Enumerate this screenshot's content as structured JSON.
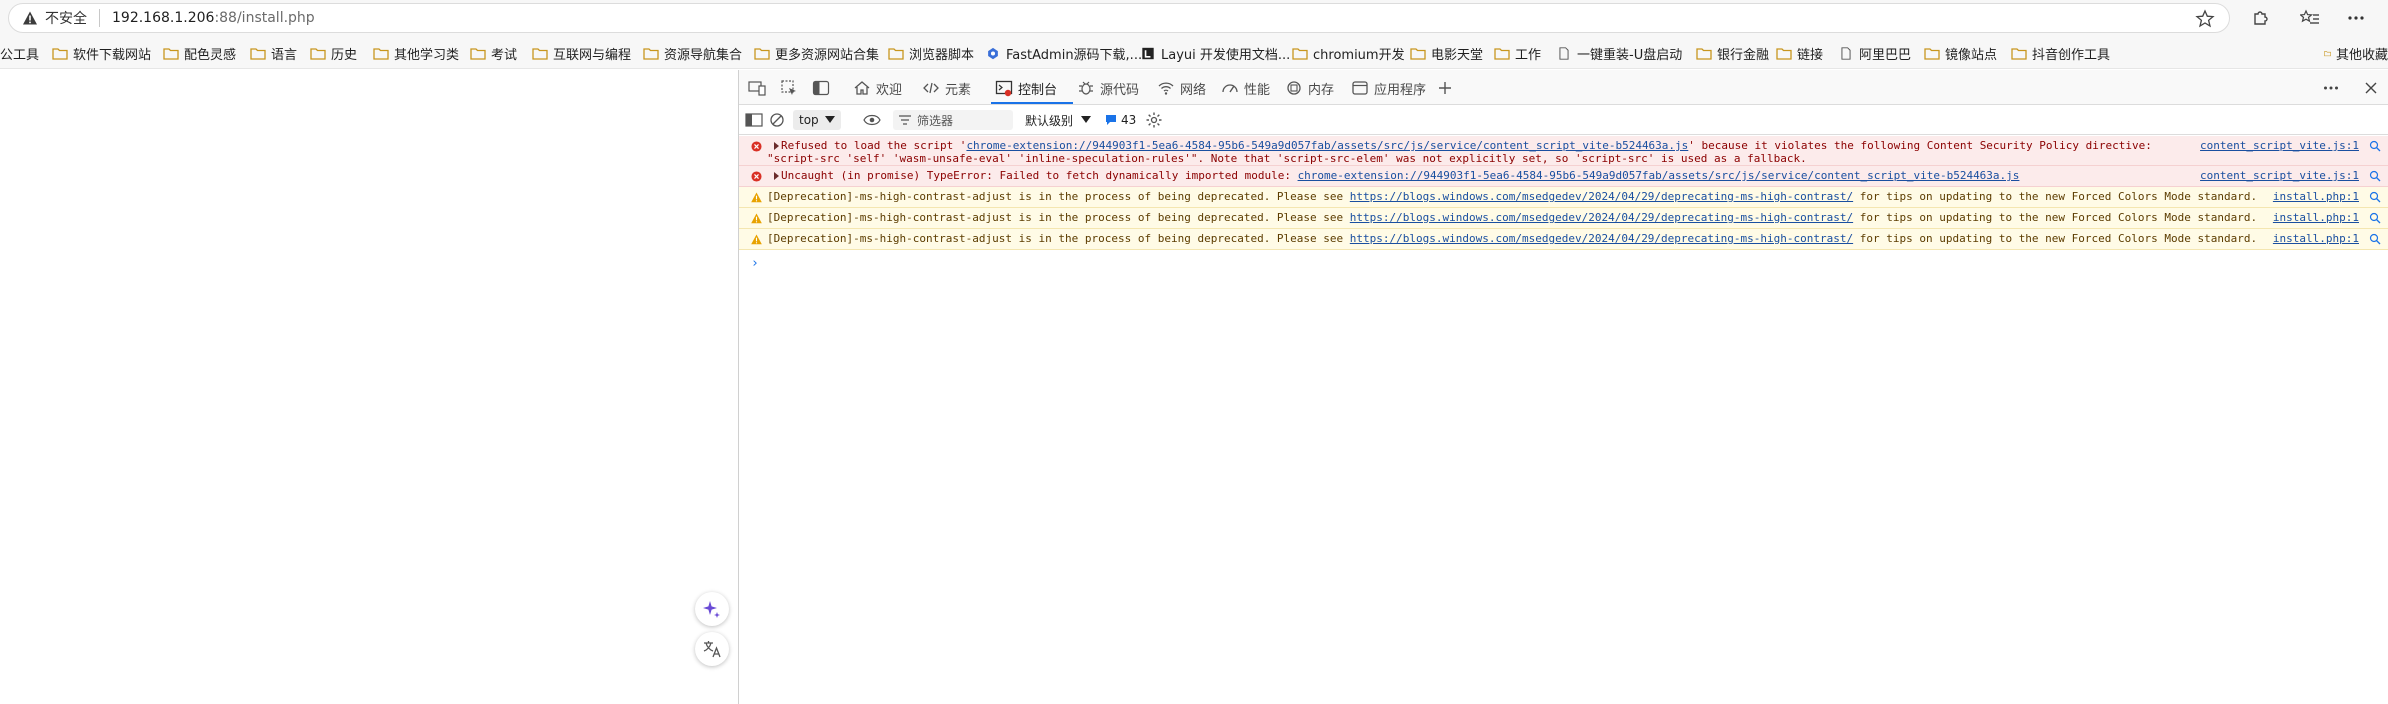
{
  "address_bar": {
    "insecure_label": "不安全",
    "url_host": "192.168.1.206",
    "url_rest": ":88/install.php"
  },
  "bookmarks": {
    "items": [
      {
        "label": "公工具",
        "icon": "folder-icon"
      },
      {
        "label": "软件下载网站",
        "icon": "folder-icon"
      },
      {
        "label": "配色灵感",
        "icon": "folder-icon"
      },
      {
        "label": "语言",
        "icon": "folder-icon"
      },
      {
        "label": "历史",
        "icon": "folder-icon"
      },
      {
        "label": "其他学习类",
        "icon": "folder-icon"
      },
      {
        "label": "考试",
        "icon": "folder-icon"
      },
      {
        "label": "互联网与编程",
        "icon": "folder-icon"
      },
      {
        "label": "资源导航集合",
        "icon": "folder-icon"
      },
      {
        "label": "更多资源网站合集",
        "icon": "folder-icon"
      },
      {
        "label": "浏览器脚本",
        "icon": "folder-icon"
      },
      {
        "label": "FastAdmin源码下载,...",
        "icon": "fastadmin-icon"
      },
      {
        "label": "Layui 开发使用文档...",
        "icon": "layui-icon"
      },
      {
        "label": "chromium开发",
        "icon": "folder-icon"
      },
      {
        "label": "电影天堂",
        "icon": "folder-icon"
      },
      {
        "label": "工作",
        "icon": "folder-icon"
      },
      {
        "label": "一键重装-U盘启动",
        "icon": "page-icon"
      },
      {
        "label": "银行金融",
        "icon": "folder-icon"
      },
      {
        "label": "链接",
        "icon": "folder-icon"
      },
      {
        "label": "阿里巴巴",
        "icon": "page-icon"
      },
      {
        "label": "镜像站点",
        "icon": "folder-icon"
      },
      {
        "label": "抖音创作工具",
        "icon": "folder-icon"
      }
    ],
    "overflow_label": "其他收藏"
  },
  "devtools": {
    "tabs": [
      {
        "label": "欢迎",
        "icon": "home-icon"
      },
      {
        "label": "元素",
        "icon": "code-icon"
      },
      {
        "label": "控制台",
        "icon": "console-icon",
        "active": true
      },
      {
        "label": "源代码",
        "icon": "bug-icon"
      },
      {
        "label": "网络",
        "icon": "wifi-icon"
      },
      {
        "label": "性能",
        "icon": "gauge-icon"
      },
      {
        "label": "内存",
        "icon": "memory-icon"
      },
      {
        "label": "应用程序",
        "icon": "app-icon"
      }
    ],
    "toolbar": {
      "context": "top",
      "filter_placeholder": "筛选器",
      "levels": "默认级别",
      "issues_count": "43"
    },
    "console_messages": [
      {
        "level": "error",
        "line1_prefix": "Refused to load the script '",
        "line1_link": "chrome-extension://944903f1-5ea6-4584-95b6-549a9d057fab/assets/src/js/service/content_script_vite-b524463a.js",
        "line1_suffix": "' because it violates the following Content Security Policy directive:",
        "line2": "\"script-src 'self' 'wasm-unsafe-eval' 'inline-speculation-rules'\". Note that 'script-src-elem' was not explicitly set, so 'script-src' is used as a fallback.",
        "source": "content_script_vite.js:1"
      },
      {
        "level": "error",
        "line1_prefix": "Uncaught (in promise) TypeError: Failed to fetch dynamically imported module: ",
        "line1_link": "chrome-extension://944903f1-5ea6-4584-95b6-549a9d057fab/assets/src/js/service/content_script_vite-b524463a.js",
        "source": "content_script_vite.js:1"
      },
      {
        "level": "warning",
        "prefix": "[Deprecation]-ms-high-contrast-adjust is in the process of being deprecated. Please see ",
        "link": "https://blogs.windows.com/msedgedev/2024/04/29/deprecating-ms-high-contrast/",
        "suffix": " for tips on updating to the new Forced Colors Mode standard.",
        "source": "install.php:1"
      },
      {
        "level": "warning",
        "prefix": "[Deprecation]-ms-high-contrast-adjust is in the process of being deprecated. Please see ",
        "link": "https://blogs.windows.com/msedgedev/2024/04/29/deprecating-ms-high-contrast/",
        "suffix": " for tips on updating to the new Forced Colors Mode standard.",
        "source": "install.php:1"
      },
      {
        "level": "warning",
        "prefix": "[Deprecation]-ms-high-contrast-adjust is in the process of being deprecated. Please see ",
        "link": "https://blogs.windows.com/msedgedev/2024/04/29/deprecating-ms-high-contrast/",
        "suffix": " for tips on updating to the new Forced Colors Mode standard.",
        "source": "install.php:1"
      }
    ],
    "prompt_glyph": "›"
  },
  "colors": {
    "accent": "#1a73e8",
    "error_bg": "#fcebeb",
    "warning_bg": "#fffbe6",
    "folder": "#e8b740"
  }
}
